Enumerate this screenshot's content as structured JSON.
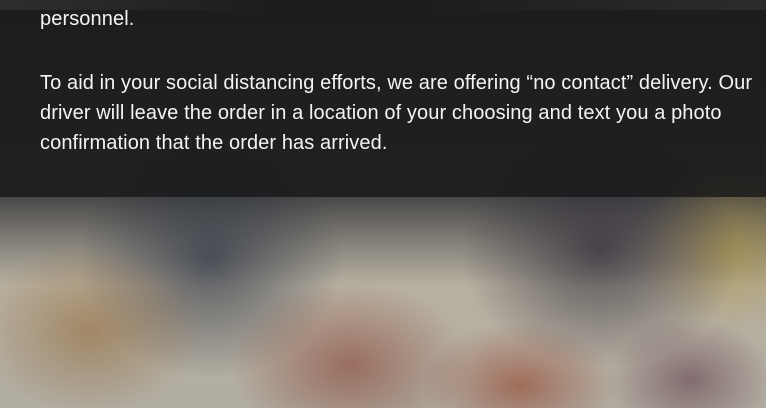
{
  "screen": {
    "overlay_color": "#121212",
    "text_color": "#f4f4f4"
  },
  "content": {
    "line_top": "personnel.",
    "paragraph": "To aid in your social distancing efforts, we are offering “no contact” delivery. Our driver will leave the order in a location of your choosing and text you a photo confirmation that the order has arrived."
  },
  "image": {
    "alt": "blurred banquet photo background"
  }
}
